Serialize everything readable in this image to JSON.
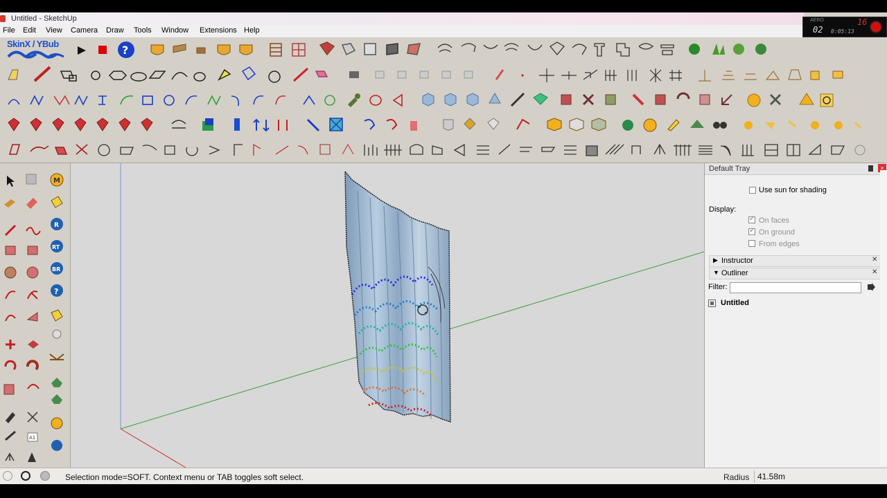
{
  "window": {
    "title": "Untitled - SketchUp"
  },
  "recorder": {
    "brand": "AERO",
    "time_main": "02",
    "time_sub": "0:05:13",
    "fps": "16"
  },
  "menu": [
    "File",
    "Edit",
    "View",
    "Camera",
    "Draw",
    "Tools",
    "Window",
    "Extensions",
    "Help"
  ],
  "toolbar": {
    "skinx_label": "SkinX / YBub"
  },
  "tray": {
    "title": "Default Tray",
    "use_sun": "Use sun for shading",
    "display": "Display:",
    "on_faces": "On faces",
    "on_ground": "On ground",
    "from_edges": "From edges",
    "instructor": "Instructor",
    "outliner": "Outliner",
    "filter": "Filter:",
    "model": "Untitled"
  },
  "status": {
    "message": "Selection mode=SOFT.  Context menu or TAB toggles soft select.",
    "radius_label": "Radius",
    "radius_value": "41.58m"
  },
  "colors": {
    "accent": "#1a4fd0",
    "axis_green": "#3aa03a",
    "axis_red": "#d03030",
    "axis_blue": "#3050d0"
  }
}
